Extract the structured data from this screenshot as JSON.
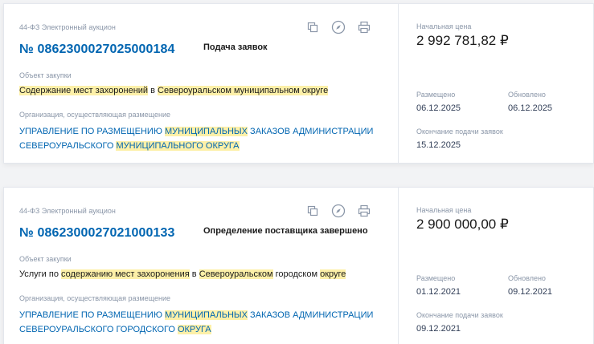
{
  "cards": [
    {
      "law": "44-ФЗ Электронный аукцион",
      "number": "№ 0862300027025000184",
      "status": "Подача заявок",
      "object_label": "Объект закупки",
      "object_parts": [
        {
          "t": "Содержание мест захоронений",
          "h": true
        },
        {
          "t": " в ",
          "h": false
        },
        {
          "t": "Североуральском муниципальном округе",
          "h": true
        }
      ],
      "org_label": "Организация, осуществляющая размещение",
      "org_parts": [
        {
          "t": "УПРАВЛЕНИЕ ПО РАЗМЕЩЕНИЮ ",
          "h": false
        },
        {
          "t": "МУНИЦИПАЛЬНЫХ",
          "h": true
        },
        {
          "t": " ЗАКАЗОВ АДМИНИСТРАЦИИ СЕВЕРОУРАЛЬСКОГО ",
          "h": false
        },
        {
          "t": "МУНИЦИПАЛЬНОГО ОКРУГА",
          "h": true
        }
      ],
      "price_label": "Начальная цена",
      "price": "2 992 781,82 ₽",
      "posted_label": "Размещено",
      "posted": "06.12.2025",
      "updated_label": "Обновлено",
      "updated": "06.12.2025",
      "deadline_label": "Окончание подачи заявок",
      "deadline": "15.12.2025"
    },
    {
      "law": "44-ФЗ Электронный аукцион",
      "number": "№ 0862300027021000133",
      "status": "Определение поставщика завершено",
      "object_label": "Объект закупки",
      "object_parts": [
        {
          "t": "Услуги по ",
          "h": false
        },
        {
          "t": "содержанию мест захоронения",
          "h": true
        },
        {
          "t": " в ",
          "h": false
        },
        {
          "t": "Североуральском",
          "h": true
        },
        {
          "t": " городском ",
          "h": false
        },
        {
          "t": "округе",
          "h": true
        }
      ],
      "org_label": "Организация, осуществляющая размещение",
      "org_parts": [
        {
          "t": "УПРАВЛЕНИЕ ПО РАЗМЕЩЕНИЮ ",
          "h": false
        },
        {
          "t": "МУНИЦИПАЛЬНЫХ",
          "h": true
        },
        {
          "t": " ЗАКАЗОВ АДМИНИСТРАЦИИ СЕВЕРОУРАЛЬСКОГО ГОРОДСКОГО ",
          "h": false
        },
        {
          "t": "ОКРУГА",
          "h": true
        }
      ],
      "price_label": "Начальная цена",
      "price": "2 900 000,00 ₽",
      "posted_label": "Размещено",
      "posted": "01.12.2021",
      "updated_label": "Обновлено",
      "updated": "09.12.2021",
      "deadline_label": "Окончание подачи заявок",
      "deadline": "09.12.2021"
    }
  ],
  "icons": [
    "copy-icon",
    "compass-icon",
    "print-icon"
  ],
  "colors": {
    "link": "#0065b1",
    "highlight": "#fdf0a8",
    "muted": "#8a96a8"
  }
}
